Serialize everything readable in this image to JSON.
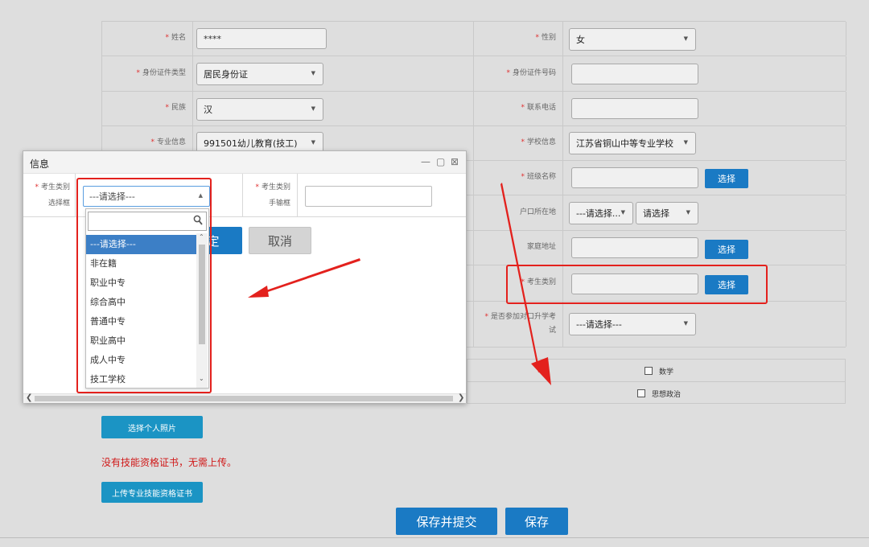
{
  "form": {
    "rows": [
      {
        "left_label": "姓名",
        "left_value": "****",
        "right_label": "性别",
        "right_value": "女"
      },
      {
        "left_label": "身份证件类型",
        "left_value": "居民身份证",
        "right_label": "身份证件号码",
        "right_value": ""
      },
      {
        "left_label": "民族",
        "left_value": "汉",
        "right_label": "联系电话",
        "right_value": ""
      },
      {
        "left_label": "专业信息",
        "left_value": "991501幼儿教育(技工)",
        "right_label": "学校信息",
        "right_value": "江苏省铜山中等专业学校"
      },
      {
        "right_label": "班级名称",
        "right_button": "选择"
      },
      {
        "right_label": "户口所在地",
        "right_select_1": "---请选择...",
        "right_select_2": "请选择"
      },
      {
        "right_label": "家庭地址",
        "right_button": "选择"
      },
      {
        "right_label": "考生类别",
        "right_button": "选择"
      },
      {
        "right_label_line1": "是否参加对口升学考",
        "right_label_line2": "试",
        "right_value": "---请选择---"
      }
    ],
    "subjects": [
      "数学",
      "思想政治"
    ]
  },
  "photo_button": "选择个人照片",
  "notice": "没有技能资格证书，无需上传。",
  "upload_button": "上传专业技能资格证书",
  "bottom_buttons": {
    "save_submit": "保存并提交",
    "save": "保存"
  },
  "modal": {
    "title": "信息",
    "window_buttons": {
      "minimize": "—",
      "maximize": "▢",
      "close": "⊠"
    },
    "select_label_line1": "考生类别",
    "select_label_line2": "选择框",
    "select_value": "---请选择---",
    "input_label_line1": "考生类别",
    "input_label_line2": "手输框",
    "confirm": "定",
    "cancel": "取消"
  },
  "dropdown": {
    "search_placeholder": "",
    "options": [
      "---请选择---",
      "非在籍",
      "职业中专",
      "综合高中",
      "普通中专",
      "职业高中",
      "成人中专",
      "技工学校"
    ],
    "selected_index": 0
  },
  "colors": {
    "primary": "#1a7ac4",
    "cyan": "#1b94c4",
    "highlight": "#e3211d",
    "notice": "#d01818",
    "selected": "#3c7fc6"
  }
}
